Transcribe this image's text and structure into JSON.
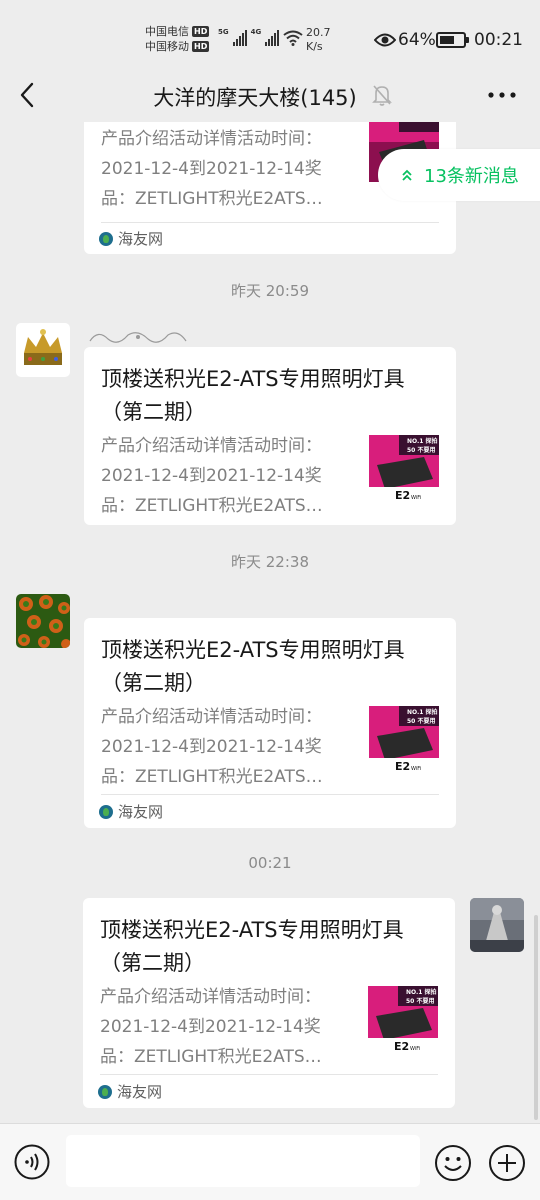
{
  "status_bar": {
    "carrier1": "中国电信",
    "carrier2": "中国移动",
    "hd": "HD",
    "net1": "5G",
    "net2": "4G",
    "speed_value": "20.7",
    "speed_unit": "K/s",
    "battery_percent": "64%",
    "battery_level": 0.64,
    "time": "00:21"
  },
  "nav": {
    "title": "大洋的摩天大楼(145)"
  },
  "new_messages": {
    "label": "13条新消息",
    "color": "#07c160"
  },
  "messages": [
    {
      "title": "",
      "desc_lines": [
        "产品介绍活动详情活动时间：",
        "2021-12-4到2021-12-14奖",
        "品：ZETLIGHT积光E2ATS…"
      ],
      "source": "海友网"
    },
    {
      "time": "昨天 20:59",
      "title": "顶楼送积光E2-ATS专用照明灯具（第二期）",
      "desc_lines": [
        "产品介绍活动详情活动时间：",
        "2021-12-4到2021-12-14奖",
        "品：ZETLIGHT积光E2ATS…"
      ]
    },
    {
      "time": "昨天 22:38",
      "title": "顶楼送积光E2-ATS专用照明灯具（第二期）",
      "desc_lines": [
        "产品介绍活动详情活动时间：",
        "2021-12-4到2021-12-14奖",
        "品：ZETLIGHT积光E2ATS…"
      ],
      "source": "海友网"
    },
    {
      "time": "00:21",
      "title": "顶楼送积光E2-ATS专用照明灯具（第二期）",
      "desc_lines": [
        "产品介绍活动详情活动时间：",
        "2021-12-4到2021-12-14奖",
        "品：ZETLIGHT积光E2ATS…"
      ],
      "source": "海友网"
    }
  ],
  "thumb": {
    "line1": "NO.1 探拍",
    "line2": "50 不要用",
    "brand": "E2",
    "brand_sub": "WiFi"
  },
  "input": {
    "placeholder": ""
  }
}
